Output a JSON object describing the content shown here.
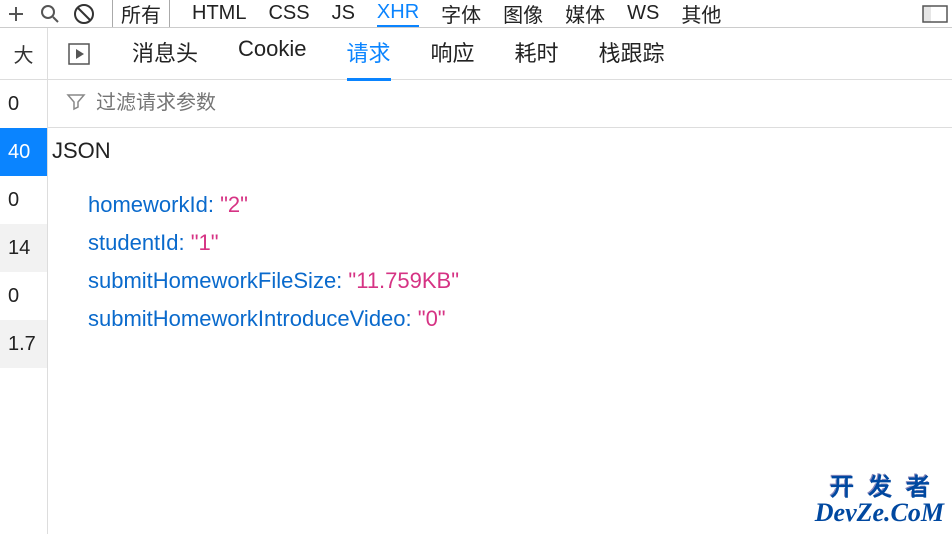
{
  "toolbar": {
    "filters": [
      "所有",
      "HTML",
      "CSS",
      "JS",
      "XHR",
      "字体",
      "图像",
      "媒体",
      "WS",
      "其他"
    ]
  },
  "leftHeader": "大",
  "leftRows": [
    {
      "text": "0",
      "cls": ""
    },
    {
      "text": "40",
      "cls": "selected"
    },
    {
      "text": "0",
      "cls": ""
    },
    {
      "text": "14",
      "cls": "alt"
    },
    {
      "text": "0",
      "cls": ""
    },
    {
      "text": "1.7",
      "cls": "alt"
    }
  ],
  "detailTabs": [
    "消息头",
    "Cookie",
    "请求",
    "响应",
    "耗时",
    "栈跟踪"
  ],
  "activeTabIndex": 2,
  "filterPlaceholder": "过滤请求参数",
  "jsonLabel": "JSON",
  "jsonData": [
    {
      "key": "homeworkId",
      "val": "\"2\""
    },
    {
      "key": "studentId",
      "val": "\"1\""
    },
    {
      "key": "submitHomeworkFileSize",
      "val": "\"11.759KB\""
    },
    {
      "key": "submitHomeworkIntroduceVideo",
      "val": "\"0\""
    }
  ],
  "watermark": {
    "line1": "开发者",
    "line2": "DevZe.CoM"
  }
}
